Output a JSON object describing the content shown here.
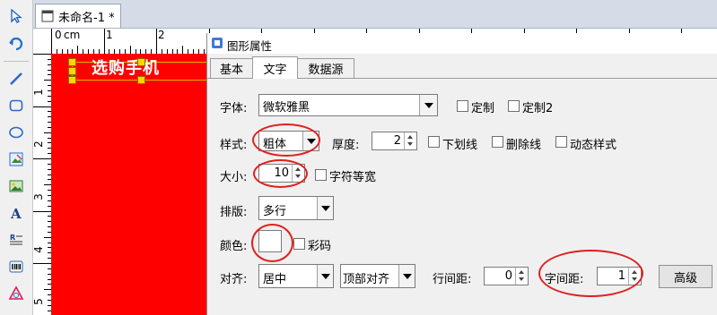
{
  "left_toolbar": {
    "icons": [
      "pointer-icon",
      "rotate-icon",
      "line-icon",
      "rounded-rect-icon",
      "ellipse-icon",
      "image-edit-icon",
      "image-icon",
      "text-icon",
      "rich-text-icon",
      "barcode-icon",
      "shape-icon"
    ]
  },
  "document": {
    "tab_label": "未命名-1 *"
  },
  "rulers": {
    "unit": "cm",
    "h_labels": [
      "0",
      "1",
      "2"
    ],
    "v_labels": [
      "1",
      "2",
      "3",
      "4",
      "5"
    ]
  },
  "canvas": {
    "selected_text": "选购手机"
  },
  "dialog": {
    "title": "图形属性",
    "tabs": [
      "基本",
      "文字",
      "数据源"
    ],
    "active_tab": "文字",
    "font": {
      "label": "字体:",
      "value": "微软雅黑",
      "custom_label": "定制",
      "custom2_label": "定制2"
    },
    "style": {
      "label": "样式:",
      "value": "粗体",
      "thickness_label": "厚度:",
      "thickness_value": "2",
      "underline_label": "下划线",
      "strike_label": "删除线",
      "dynamic_label": "动态样式"
    },
    "size": {
      "label": "大小:",
      "value": "10",
      "monospace_label": "字符等宽"
    },
    "layout": {
      "label": "排版:",
      "value": "多行"
    },
    "color": {
      "label": "颜色:",
      "swatch": "#ffffff",
      "colorcode_label": "彩码"
    },
    "align": {
      "label": "对齐:",
      "h_value": "居中",
      "v_value": "顶部对齐",
      "line_spacing_label": "行间距:",
      "line_spacing_value": "0",
      "char_spacing_label": "字间距:",
      "char_spacing_value": "1",
      "advanced_button": "高级"
    }
  },
  "colors": {
    "label_background": "#ff0000",
    "annotation": "#e02020",
    "handle": "#ffd400"
  }
}
